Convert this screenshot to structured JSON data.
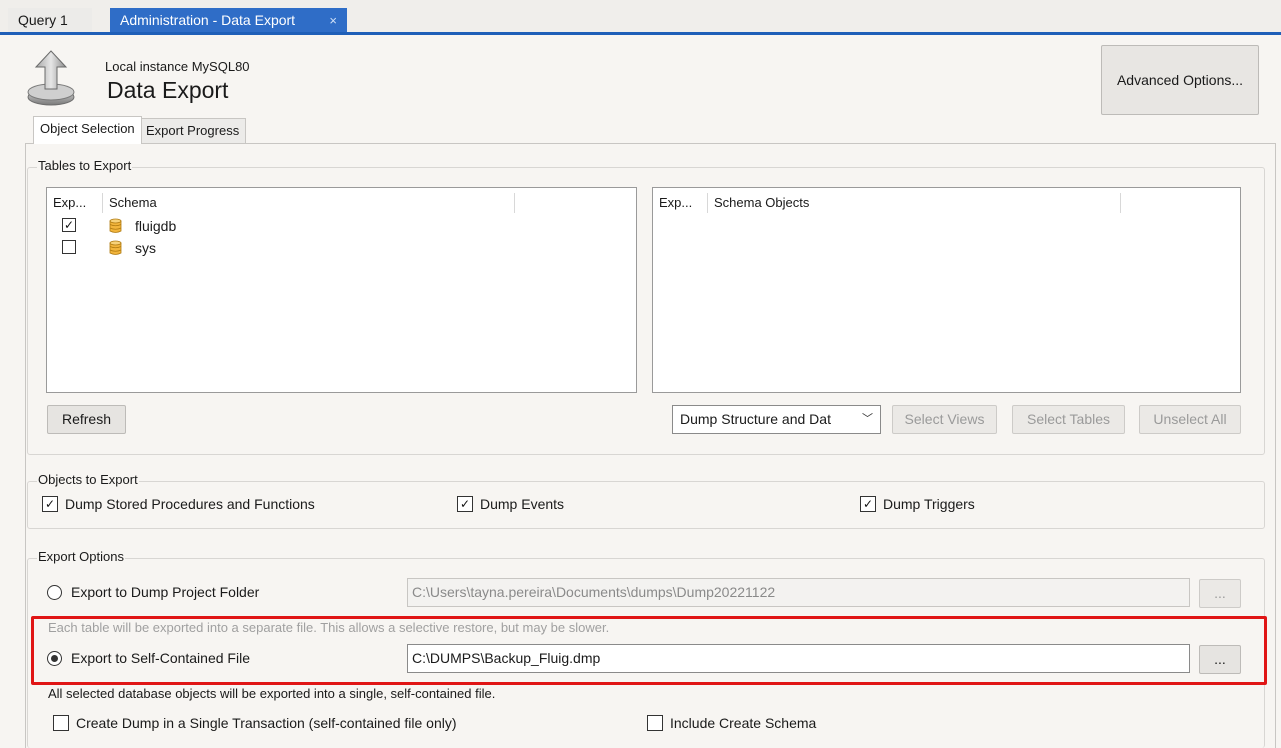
{
  "tabs": [
    {
      "label": "Query 1"
    },
    {
      "label": "Administration - Data Export",
      "close": "×"
    }
  ],
  "header": {
    "instance": "Local instance MySQL80",
    "title": "Data Export",
    "advanced_button": "Advanced Options..."
  },
  "inner_tabs": [
    "Object Selection",
    "Export Progress"
  ],
  "tables_group": {
    "title": "Tables to Export",
    "schema_list": {
      "col_export": "Exp...",
      "col_schema": "Schema",
      "rows": [
        {
          "checked": true,
          "check_mark": "✓",
          "name": "fluigdb"
        },
        {
          "checked": false,
          "check_mark": "",
          "name": "sys"
        }
      ]
    },
    "objects_list": {
      "col_export": "Exp...",
      "col_objects": "Schema Objects"
    },
    "refresh": "Refresh",
    "dump_select": {
      "value": "Dump Structure and Dat",
      "arrow": "﹀"
    },
    "select_views": "Select Views",
    "select_tables": "Select Tables",
    "unselect_all": "Unselect All"
  },
  "objects_group": {
    "title": "Objects to Export",
    "items": [
      {
        "label": "Dump Stored Procedures and Functions",
        "checked": true,
        "check_mark": "✓"
      },
      {
        "label": "Dump Events",
        "checked": true,
        "check_mark": "✓"
      },
      {
        "label": "Dump Triggers",
        "checked": true,
        "check_mark": "✓"
      }
    ]
  },
  "options_group": {
    "title": "Export Options",
    "folder_option": {
      "label": "Export to Dump Project Folder",
      "selected": false,
      "path": "C:\\Users\\tayna.pereira\\Documents\\dumps\\Dump20221122",
      "browse": "...",
      "hint": "Each table will be exported into a separate file. This allows a selective restore, but may be slower."
    },
    "file_option": {
      "label": "Export to Self-Contained File",
      "selected": true,
      "path": "C:\\DUMPS\\Backup_Fluig.dmp",
      "browse": "...",
      "hint": "All selected database objects will be exported into a single, self-contained file."
    },
    "single_transaction": {
      "label": "Create Dump in a Single Transaction (self-contained file only)",
      "checked": false,
      "check_mark": ""
    },
    "include_schema": {
      "label": "Include Create Schema",
      "checked": false,
      "check_mark": ""
    }
  },
  "colors": {
    "accent_tab": "#2f6dc7",
    "highlight": "#e01515",
    "db_icon": "#f2b53c"
  }
}
